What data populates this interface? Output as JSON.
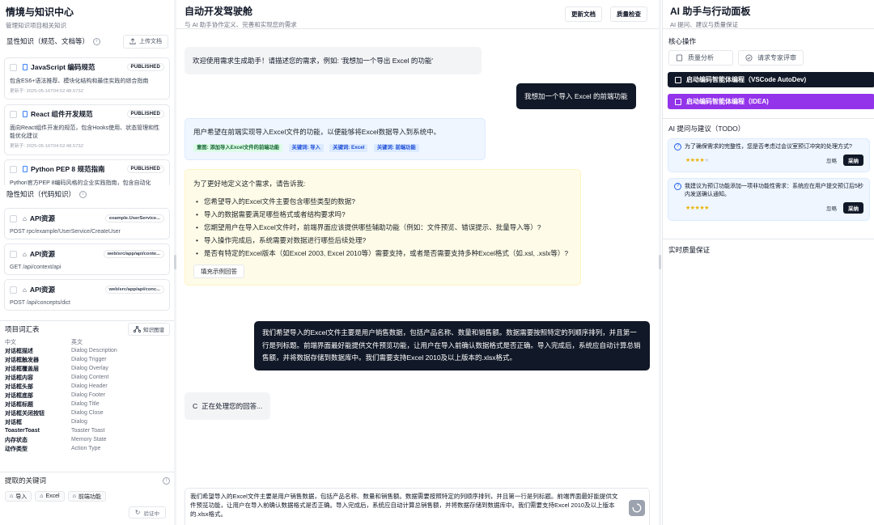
{
  "left": {
    "title": "情境与知识中心",
    "subtitle": "管理知识项目相关知识",
    "explicit_title": "显性知识（规范、文档等）",
    "upload_label": "上传文档",
    "docs": [
      {
        "title": "JavaScript 编码规范",
        "status": "PUBLISHED",
        "desc": "包含ES6+语法推荐、模块化结构和最佳实践的综合指南",
        "updated": "更新于: 2025-05-16T04:52:48.573Z"
      },
      {
        "title": "React 组件开发规范",
        "status": "PUBLISHED",
        "desc": "面向React组件开发的规范，包含Hooks使用、状态管理和性能优化建议",
        "updated": "更新于: 2025-05-16T04:52:48.573Z"
      },
      {
        "title": "Python PEP 8 规范指南",
        "status": "PUBLISHED",
        "desc": "Python官方PEP 8编码风格的企业实践指南，包含自动化",
        "updated": ""
      }
    ],
    "implicit_title": "隐性知识（代码知识）",
    "apis": [
      {
        "title": "API资源",
        "chip": "example.UserService...",
        "path": "POST rpc/example/UserService/CreateUser"
      },
      {
        "title": "API资源",
        "chip": "web/src/app/api/conte...",
        "path": "GET /api/context/api"
      },
      {
        "title": "API资源",
        "chip": "web/src/app/api/conc...",
        "path": "POST /api/concepts/dict"
      }
    ],
    "vocab_title": "项目词汇表",
    "kg_label": "知识图谱",
    "vocab_header": {
      "zh": "中文",
      "en": "英文"
    },
    "vocab": [
      {
        "zh": "对话框描述",
        "en": "Dialog Description"
      },
      {
        "zh": "对话框触发器",
        "en": "Dialog Trigger"
      },
      {
        "zh": "对话框覆盖层",
        "en": "Dialog Overlay"
      },
      {
        "zh": "对话框内容",
        "en": "Dialog Content"
      },
      {
        "zh": "对话框头部",
        "en": "Dialog Header"
      },
      {
        "zh": "对话框底部",
        "en": "Dialog Footer"
      },
      {
        "zh": "对话框标题",
        "en": "Dialog Title"
      },
      {
        "zh": "对话框关闭按钮",
        "en": "Dialog Close"
      },
      {
        "zh": "对话框",
        "en": "Dialog"
      },
      {
        "zh": "ToasterToast",
        "en": "Toaster Toast"
      },
      {
        "zh": "内存状态",
        "en": "Memory State"
      },
      {
        "zh": "动作类型",
        "en": "Action Type"
      }
    ],
    "keywords_title": "提取的关键词",
    "keywords": [
      "导入",
      "Excel",
      "前端功能"
    ],
    "verify_label": "验证中"
  },
  "center": {
    "title": "自动开发驾驶舱",
    "subtitle": "与 AI 助手协作定义、完善和实现您的需求",
    "btn_update": "更新文档",
    "btn_quality": "质量检查",
    "welcome": "欢迎使用需求生成助手！请描述您的需求，例如: '我想加一个导出 Excel 的功能'",
    "user1": "我想加一个导入 Excel 的前端功能",
    "analysis": "用户希望在前端实现导入Excel文件的功能，以便能够将Excel数据导入到系统中。",
    "intent": "意图: 添加导入Excel文件的前端功能",
    "kw_chips": [
      "关键词: 导入",
      "关键词: Excel",
      "关键词: 前端功能"
    ],
    "clarify_intro": "为了更好地定义这个需求，请告诉我:",
    "questions": [
      "您希望导入的Excel文件主要包含哪些类型的数据?",
      "导入的数据需要满足哪些格式或者结构要求吗?",
      "您期望用户在导入Excel文件时，前端界面应该提供哪些辅助功能（例如：文件预览、错误提示、批量导入等）?",
      "导入操作完成后，系统需要对数据进行哪些后续处理?",
      "是否有特定的Excel版本（如Excel 2003, Excel 2010等）需要支持，或者是否需要支持多种Excel格式（如.xsl, .xslx等）?"
    ],
    "fill_example": "填充示例回答",
    "user2": "我们希望导入的Excel文件主要是用户销售数据，包括产品名称、数量和销售额。数据需要按照特定的列顺序排列，并且第一行是列标题。前端界面最好能提供文件预览功能，让用户在导入前确认数据格式是否正确。导入完成后，系统应自动计算总销售额，并将数据存储到数据库中。我们需要支持Excel 2010及以上版本的.xlsx格式。",
    "processing": "正在处理您的回答...",
    "input_value": "我们希望导入的Excel文件主要是用户销售数据，包括产品名称、数量和销售额。数据需要按照特定的列顺序排列，并且第一行是列标题。前端界面最好能提供文件预览功能，让用户在导入前确认数据格式是否正确。导入完成后，系统应自动计算总销售额，并将数据存储到数据库中。我们需要支持Excel 2010及以上版本的.xlsx格式。"
  },
  "right": {
    "title": "AI 助手与行动面板",
    "subtitle": "AI 提问、建议与质量保证",
    "core_title": "核心操作",
    "btn_quality_analysis": "质量分析",
    "btn_expert_review": "请求专家评审",
    "btn_vscode": "启动编码智能体编程（VSCode AutoDev)",
    "btn_idea": "启动编码智能体编程（IDEA)",
    "suggest_title": "AI 提问与建议（TODO）",
    "suggestions": [
      {
        "text": "为了确保需求的完整性，您是否考虑过会议室预订冲突的处理方式?",
        "stars": 4
      },
      {
        "text": "我建议为预订功能添加一项非功能性需求：系统应在用户提交预订后5秒内发送确认通知。",
        "stars": 5
      }
    ],
    "ignore_label": "忽略",
    "adopt_label": "采纳",
    "qa_title": "实时质量保证"
  }
}
